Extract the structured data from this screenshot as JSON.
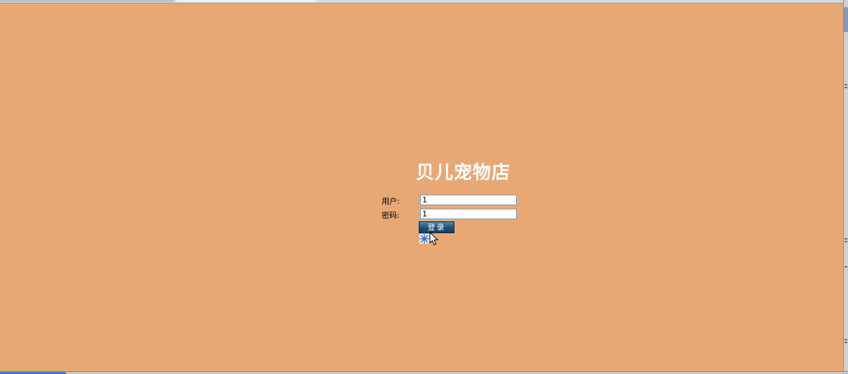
{
  "store": {
    "title": "贝儿宠物店"
  },
  "login_form": {
    "username_label": "用户:",
    "username_value": "1",
    "password_label": "密码:",
    "password_value": "1",
    "submit_label": "登录"
  },
  "icons": {
    "loading": "sparkle-icon",
    "pointer": "mouse-cursor-icon"
  },
  "colors": {
    "background": "#e8a876",
    "button": "#1f4f77",
    "title_text": "#ffffff"
  }
}
